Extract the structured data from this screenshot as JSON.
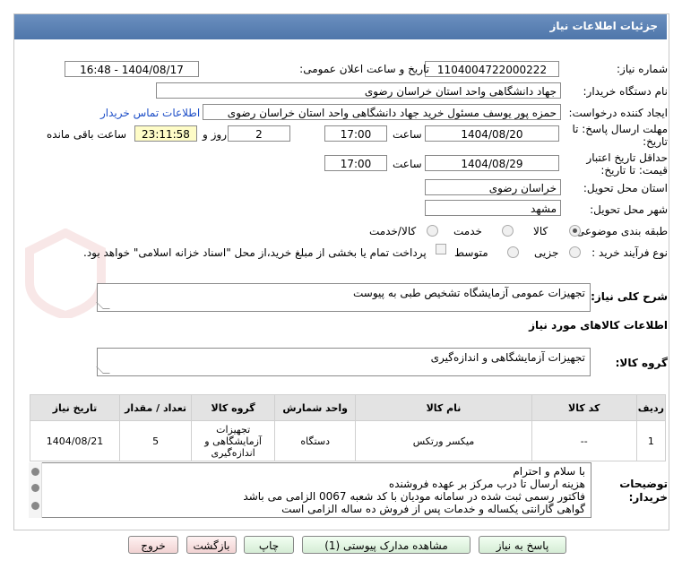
{
  "header": {
    "title": "جزئیات اطلاعات نیاز"
  },
  "form": {
    "need_number_label": "شماره نیاز:",
    "need_number": "1104004722000222",
    "announce_label": "تاریخ و ساعت اعلان عمومی:",
    "announce_value": "1404/08/17 - 16:48",
    "buyer_org_label": "نام دستگاه خریدار:",
    "buyer_org": "جهاد دانشگاهی واحد استان خراسان رضوی",
    "requester_label": "ایجاد کننده درخواست:",
    "requester": "حمزه  پور یوسف مسئول خرید جهاد دانشگاهی واحد استان خراسان رضوی",
    "contact_link": "اطلاعات تماس خریدار",
    "send_deadline_label": "مهلت ارسال پاسخ: تا تاریخ:",
    "send_deadline_date": "1404/08/20",
    "time_label": "ساعت",
    "send_deadline_time": "17:00",
    "days_value": "2",
    "days_label": "روز و",
    "remaining_time": "23:11:58",
    "remaining_label": "ساعت باقی مانده",
    "validity_label": "حداقل تاریخ اعتبار قیمت: تا تاریخ:",
    "validity_date": "1404/08/29",
    "validity_time": "17:00",
    "province_label": "استان محل تحویل:",
    "province": "خراسان رضوی",
    "city_label": "شهر محل تحویل:",
    "city": "مشهد",
    "category_label": "طبقه بندی موضوعی:",
    "category_options": [
      "کالا",
      "خدمت",
      "کالا/خدمت"
    ],
    "process_label": "نوع فرآیند خرید :",
    "process_options": [
      "جزیی",
      "متوسط"
    ],
    "payment_note": "پرداخت تمام یا بخشی از مبلغ خرید،از محل \"اسناد خزانه اسلامی\" خواهد بود.",
    "summary_label": "شرح کلی نیاز:",
    "summary": "تجهیزات عمومی آزمایشگاه تشخیص طبی به پیوست",
    "goods_section_title": "اطلاعات کالاهای مورد نیاز",
    "goods_group_label": "گروه کالا:",
    "goods_group": "تجهیزات آزمایشگاهی و اندازه‌گیری"
  },
  "table": {
    "headers": [
      "ردیف",
      "کد کالا",
      "نام کالا",
      "واحد شمارش",
      "گروه کالا",
      "تعداد / مقدار",
      "تاریخ نیاز"
    ],
    "rows": [
      {
        "row": "1",
        "code": "--",
        "name": "میکسر ورتکس",
        "unit": "دستگاه",
        "group": "تجهیزات آزمایشگاهی و اندازه‌گیری",
        "qty": "5",
        "date": "1404/08/21"
      }
    ]
  },
  "notes": {
    "label": "توضیحات خریدار:",
    "lines": [
      "با سلام و احترام",
      "هزینه ارسال تا درب مرکز بر عهده فروشنده",
      "فاکتور رسمی ثبت شده در سامانه مودیان با کد شعبه 0067 الزامی می باشد",
      "گواهی گارانتی یکساله و خدمات پس از فروش ده ساله الزامی است"
    ]
  },
  "buttons": {
    "reply": "پاسخ به نیاز",
    "docs": "مشاهده مدارک پیوستی (1)",
    "print": "چاپ",
    "back": "بازگشت",
    "exit": "خروج"
  },
  "colors": {
    "header": "#5a80b4",
    "link": "#1e4fc8",
    "highlight": "#fefcc7"
  }
}
